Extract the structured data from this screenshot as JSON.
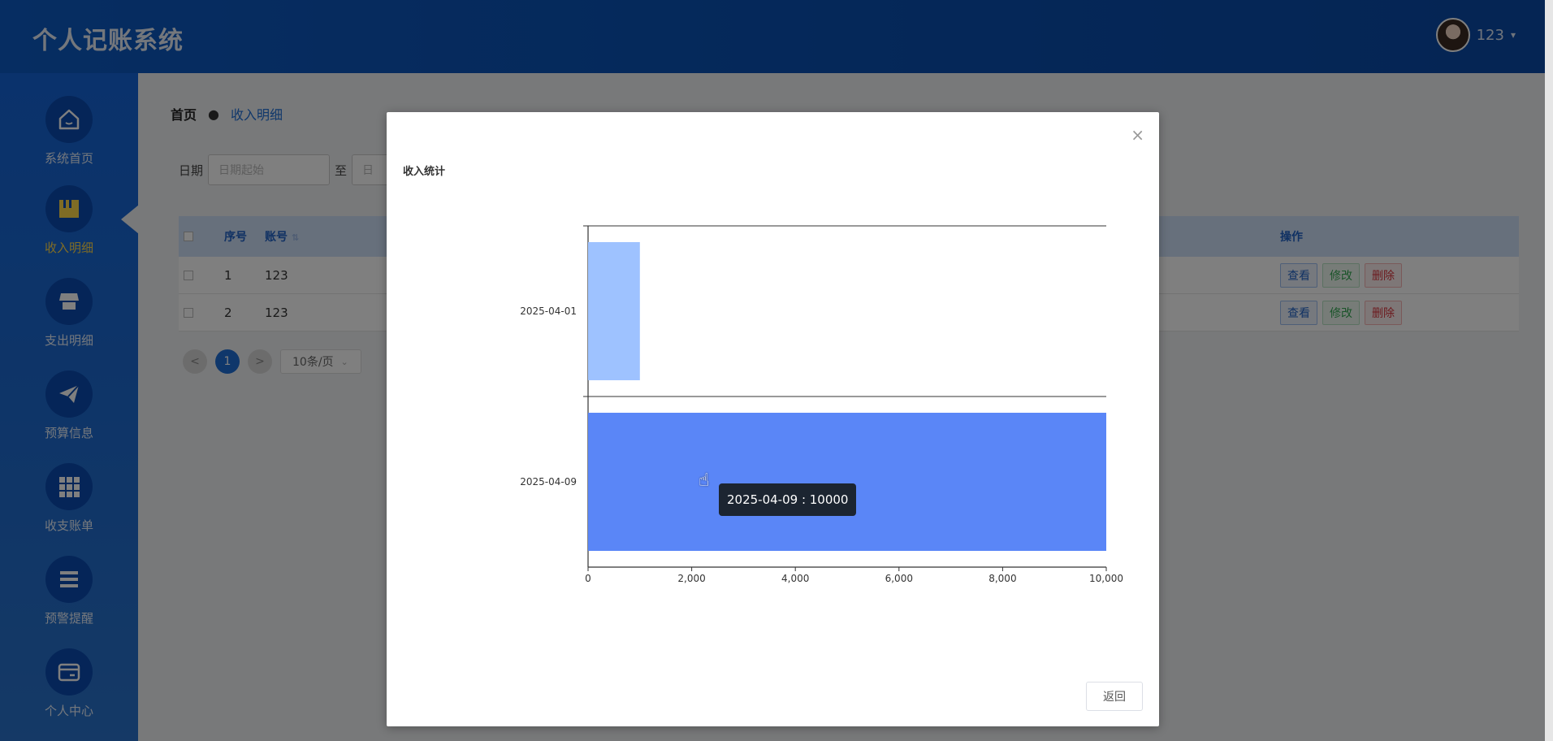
{
  "app": {
    "title": "个人记账系统"
  },
  "user": {
    "name": "123",
    "caret": "▾"
  },
  "sidebar": {
    "items": [
      {
        "label": "系统首页",
        "icon": "home-icon"
      },
      {
        "label": "收入明细",
        "icon": "income-icon",
        "active": true
      },
      {
        "label": "支出明细",
        "icon": "store-icon"
      },
      {
        "label": "预算信息",
        "icon": "send-icon"
      },
      {
        "label": "收支账单",
        "icon": "grid-icon"
      },
      {
        "label": "预警提醒",
        "icon": "list-icon"
      },
      {
        "label": "个人中心",
        "icon": "wallet-icon"
      }
    ]
  },
  "breadcrumb": {
    "home": "首页",
    "sep": "●",
    "current": "收入明细"
  },
  "filter": {
    "date_label": "日期",
    "start_placeholder": "日期起始",
    "to_label": "至",
    "end_placeholder": "日"
  },
  "table": {
    "headers": {
      "index": "序号",
      "account": "账号",
      "account_sort": "⇅",
      "ops": "操作"
    },
    "rows": [
      {
        "index": "1",
        "account": "123"
      },
      {
        "index": "2",
        "account": "123"
      }
    ],
    "buttons": {
      "view": "查看",
      "edit": "修改",
      "delete": "删除"
    }
  },
  "pager": {
    "prev": "<",
    "current": "1",
    "next": ">",
    "page_size": "10条/页",
    "page_size_caret": "⌄"
  },
  "dialog": {
    "close": "×",
    "chart_title": "收入统计",
    "tooltip": "2025-04-09 : 10000",
    "return_label": "返回"
  },
  "colors": {
    "header_bg": "#0d5bc4",
    "sidebar_bg": "#1565d8",
    "active_label": "#ffd84a",
    "bar_light": "#9ec2ff",
    "bar_dark": "#5a86f7"
  },
  "chart_data": {
    "type": "bar",
    "orientation": "horizontal",
    "categories": [
      "2025-04-01",
      "2025-04-09"
    ],
    "values": [
      1000,
      10000
    ],
    "title": "收入统计",
    "xlabel": "",
    "ylabel": "",
    "xlim": [
      0,
      10000
    ],
    "xticks": [
      0,
      2000,
      4000,
      6000,
      8000,
      10000
    ],
    "xtick_labels": [
      "0",
      "2,000",
      "4,000",
      "6,000",
      "8,000",
      "10,000"
    ],
    "grid": true
  }
}
